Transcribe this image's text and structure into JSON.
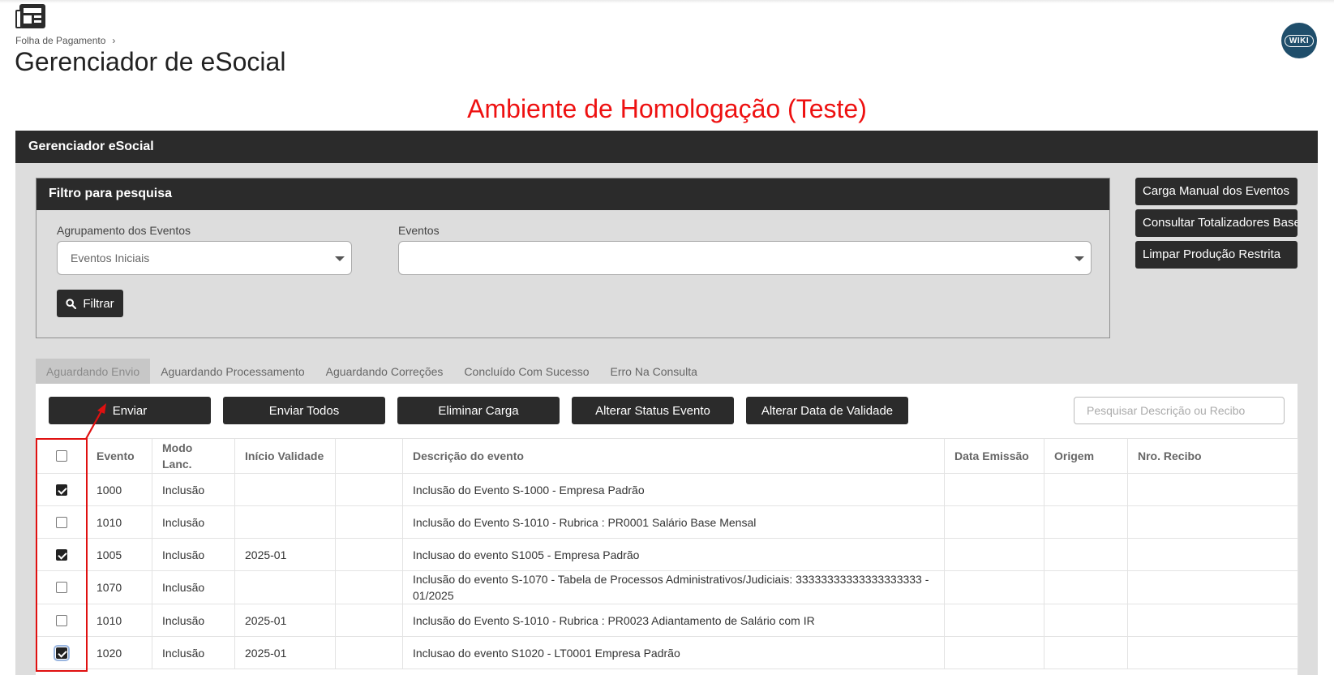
{
  "header": {
    "breadcrumb": "Folha de Pagamento",
    "breadcrumb_sep": "›",
    "title": "Gerenciador de eSocial",
    "wiki_label": "WIKI",
    "environment": "Ambiente de Homologação (Teste)"
  },
  "panel": {
    "title": "Gerenciador eSocial"
  },
  "filter": {
    "title": "Filtro para pesquisa",
    "group_label": "Agrupamento dos Eventos",
    "group_value": "Eventos Iniciais",
    "events_label": "Eventos",
    "events_value": "",
    "filter_button": "Filtrar"
  },
  "side_buttons": [
    "Carga Manual dos Eventos",
    "Consultar Totalizadores Base",
    "Limpar Produção Restrita"
  ],
  "tabs": [
    "Aguardando Envio",
    "Aguardando Processamento",
    "Aguardando Correções",
    "Concluído Com Sucesso",
    "Erro Na Consulta"
  ],
  "actions": [
    "Enviar",
    "Enviar Todos",
    "Eliminar Carga",
    "Alterar Status Evento",
    "Alterar Data de Validade"
  ],
  "search": {
    "placeholder": "Pesquisar Descrição ou Recibo"
  },
  "table": {
    "columns": [
      "",
      "Evento",
      "Modo Lanc.",
      "Início Validade",
      "",
      "Descrição do evento",
      "Data Emissão",
      "Origem",
      "Nro. Recibo"
    ],
    "rows": [
      {
        "checked": true,
        "evento": "1000",
        "modo": "Inclusão",
        "inicio": "",
        "descricao": "Inclusão do Evento S-1000 - Empresa Padrão",
        "data": "",
        "origem": "",
        "recibo": ""
      },
      {
        "checked": false,
        "evento": "1010",
        "modo": "Inclusão",
        "inicio": "",
        "descricao": "Inclusão do Evento S-1010 - Rubrica : PR0001 Salário Base Mensal",
        "data": "",
        "origem": "",
        "recibo": ""
      },
      {
        "checked": true,
        "evento": "1005",
        "modo": "Inclusão",
        "inicio": "2025-01",
        "descricao": "Inclusao do evento S1005 - Empresa Padrão",
        "data": "",
        "origem": "",
        "recibo": ""
      },
      {
        "checked": false,
        "evento": "1070",
        "modo": "Inclusão",
        "inicio": "",
        "descricao": "Inclusão do evento S-1070 - Tabela de Processos Administrativos/Judiciais: 33333333333333333333 - 01/2025",
        "data": "",
        "origem": "",
        "recibo": ""
      },
      {
        "checked": false,
        "evento": "1010",
        "modo": "Inclusão",
        "inicio": "2025-01",
        "descricao": "Inclusão do Evento S-1010 - Rubrica : PR0023 Adiantamento de Salário com IR",
        "data": "",
        "origem": "",
        "recibo": ""
      },
      {
        "checked": true,
        "evento": "1020",
        "modo": "Inclusão",
        "inicio": "2025-01",
        "descricao": "Inclusao do evento S1020 - LT0001 Empresa Padrão",
        "data": "",
        "origem": "",
        "recibo": ""
      }
    ]
  },
  "colors": {
    "dark": "#2b2b2b",
    "panel_bg": "#dddddd",
    "env_red": "#ee1111",
    "wiki_bg": "#1f4e6b",
    "annotation_red": "#e01010"
  }
}
